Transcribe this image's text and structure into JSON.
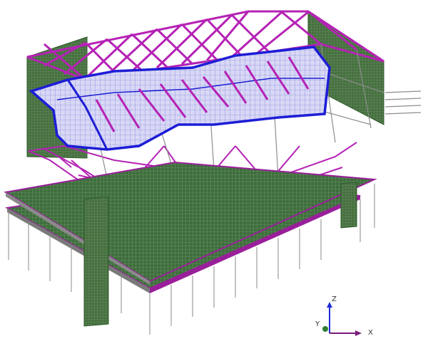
{
  "viewport": {
    "background": "#ffffff",
    "colors": {
      "slab_fill": "#3e6e3c",
      "slab_mesh": "#7f9e7c",
      "steel_truss": "#b522b5",
      "roof_shell": "#1d1dd6",
      "roof_mesh": "#8e8ed8",
      "column_line": "#8a8a8a",
      "wall_fill": "#46703f",
      "edge_line": "#9a1f9a"
    }
  },
  "axis_triad": {
    "z_label": "Z",
    "y_label": "Y",
    "x_label": "X",
    "z_color": "#1d2dd6",
    "x_color": "#7a1c7a",
    "y_color": "#2e7d32"
  }
}
